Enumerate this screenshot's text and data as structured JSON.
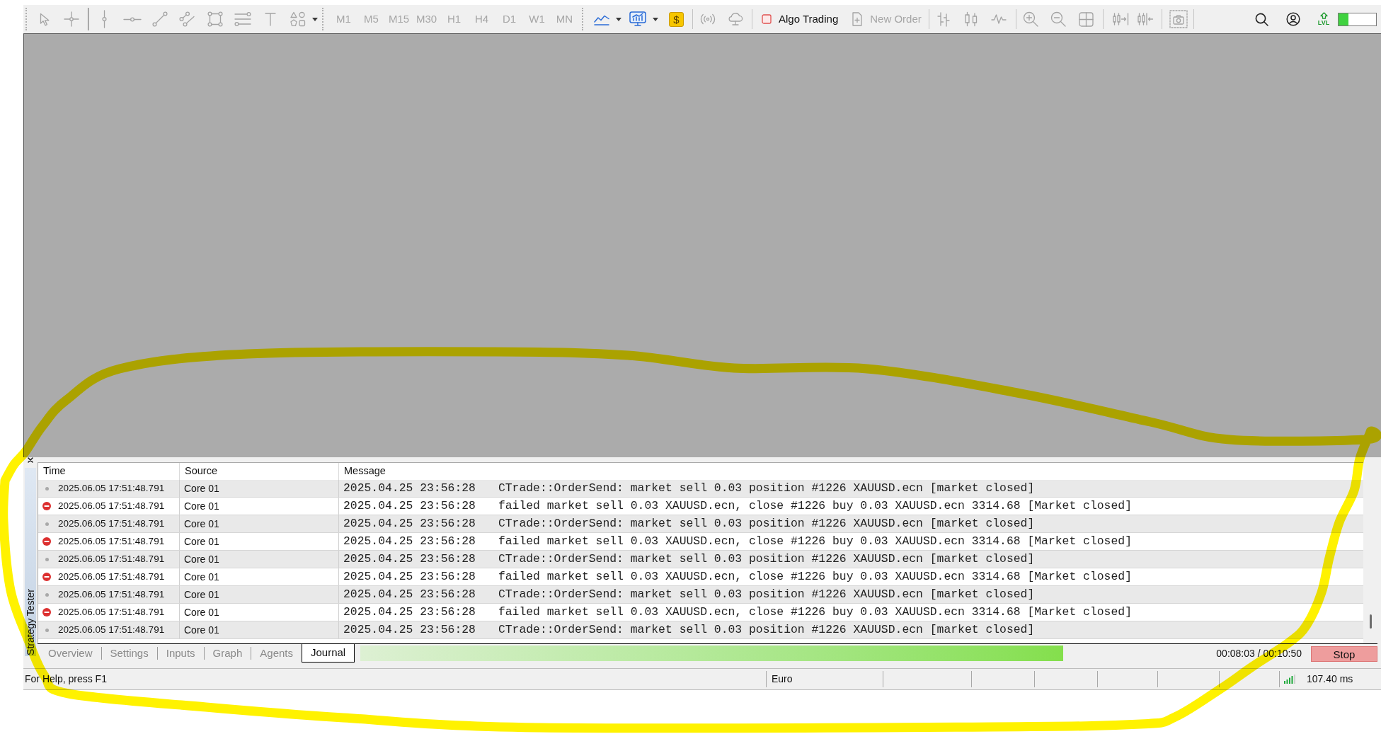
{
  "toolbar": {
    "timeframes": [
      {
        "label": "M1",
        "disabled": true
      },
      {
        "label": "M5",
        "disabled": true
      },
      {
        "label": "M15",
        "disabled": true
      },
      {
        "label": "M30",
        "disabled": true
      },
      {
        "label": "H1",
        "disabled": true
      },
      {
        "label": "H4",
        "disabled": true
      },
      {
        "label": "D1",
        "disabled": true
      },
      {
        "label": "W1",
        "disabled": true
      },
      {
        "label": "MN",
        "disabled": true
      }
    ],
    "dollar_button": {
      "label": "$"
    },
    "algo_trading": {
      "label": "Algo Trading",
      "on": false,
      "disabled": false
    },
    "new_order": {
      "label": "New Order",
      "disabled": true
    },
    "level_indicator": {
      "label": "LVL",
      "level": 0.27
    }
  },
  "tester": {
    "title": "Strategy Tester",
    "columns": [
      "Time",
      "Source",
      "Message"
    ],
    "rows": [
      {
        "kind": "info",
        "time": "2025.06.05 17:51:48.791",
        "source": "Core 01",
        "log_time": "2025.04.25 23:56:28",
        "message": "CTrade::OrderSend: market sell 0.03 position #1226 XAUUSD.ecn [market closed]"
      },
      {
        "kind": "error",
        "time": "2025.06.05 17:51:48.791",
        "source": "Core 01",
        "log_time": "2025.04.25 23:56:28",
        "message": "failed market sell 0.03 XAUUSD.ecn, close #1226 buy 0.03 XAUUSD.ecn 3314.68 [Market closed]"
      },
      {
        "kind": "info",
        "time": "2025.06.05 17:51:48.791",
        "source": "Core 01",
        "log_time": "2025.04.25 23:56:28",
        "message": "CTrade::OrderSend: market sell 0.03 position #1226 XAUUSD.ecn [market closed]"
      },
      {
        "kind": "error",
        "time": "2025.06.05 17:51:48.791",
        "source": "Core 01",
        "log_time": "2025.04.25 23:56:28",
        "message": "failed market sell 0.03 XAUUSD.ecn, close #1226 buy 0.03 XAUUSD.ecn 3314.68 [Market closed]"
      },
      {
        "kind": "info",
        "time": "2025.06.05 17:51:48.791",
        "source": "Core 01",
        "log_time": "2025.04.25 23:56:28",
        "message": "CTrade::OrderSend: market sell 0.03 position #1226 XAUUSD.ecn [market closed]"
      },
      {
        "kind": "error",
        "time": "2025.06.05 17:51:48.791",
        "source": "Core 01",
        "log_time": "2025.04.25 23:56:28",
        "message": "failed market sell 0.03 XAUUSD.ecn, close #1226 buy 0.03 XAUUSD.ecn 3314.68 [Market closed]"
      },
      {
        "kind": "info",
        "time": "2025.06.05 17:51:48.791",
        "source": "Core 01",
        "log_time": "2025.04.25 23:56:28",
        "message": "CTrade::OrderSend: market sell 0.03 position #1226 XAUUSD.ecn [market closed]"
      },
      {
        "kind": "error",
        "time": "2025.06.05 17:51:48.791",
        "source": "Core 01",
        "log_time": "2025.04.25 23:56:28",
        "message": "failed market sell 0.03 XAUUSD.ecn, close #1226 buy 0.03 XAUUSD.ecn 3314.68 [Market closed]"
      },
      {
        "kind": "info",
        "time": "2025.06.05 17:51:48.791",
        "source": "Core 01",
        "log_time": "2025.04.25 23:56:28",
        "message": "CTrade::OrderSend: market sell 0.03 position #1226 XAUUSD.ecn [market closed]"
      }
    ],
    "tabs": [
      {
        "label": "Overview",
        "selected": false
      },
      {
        "label": "Settings",
        "selected": false
      },
      {
        "label": "Inputs",
        "selected": false
      },
      {
        "label": "Graph",
        "selected": false
      },
      {
        "label": "Agents",
        "selected": false
      },
      {
        "label": "Journal",
        "selected": true
      }
    ],
    "progress": {
      "level": 0.83
    },
    "elapsed": "00:08:03 / 00:10:50",
    "stop_button": "Stop"
  },
  "status_bar": {
    "help": "For Help, press F1",
    "profile": "Euro",
    "ping": "107.40 ms"
  }
}
